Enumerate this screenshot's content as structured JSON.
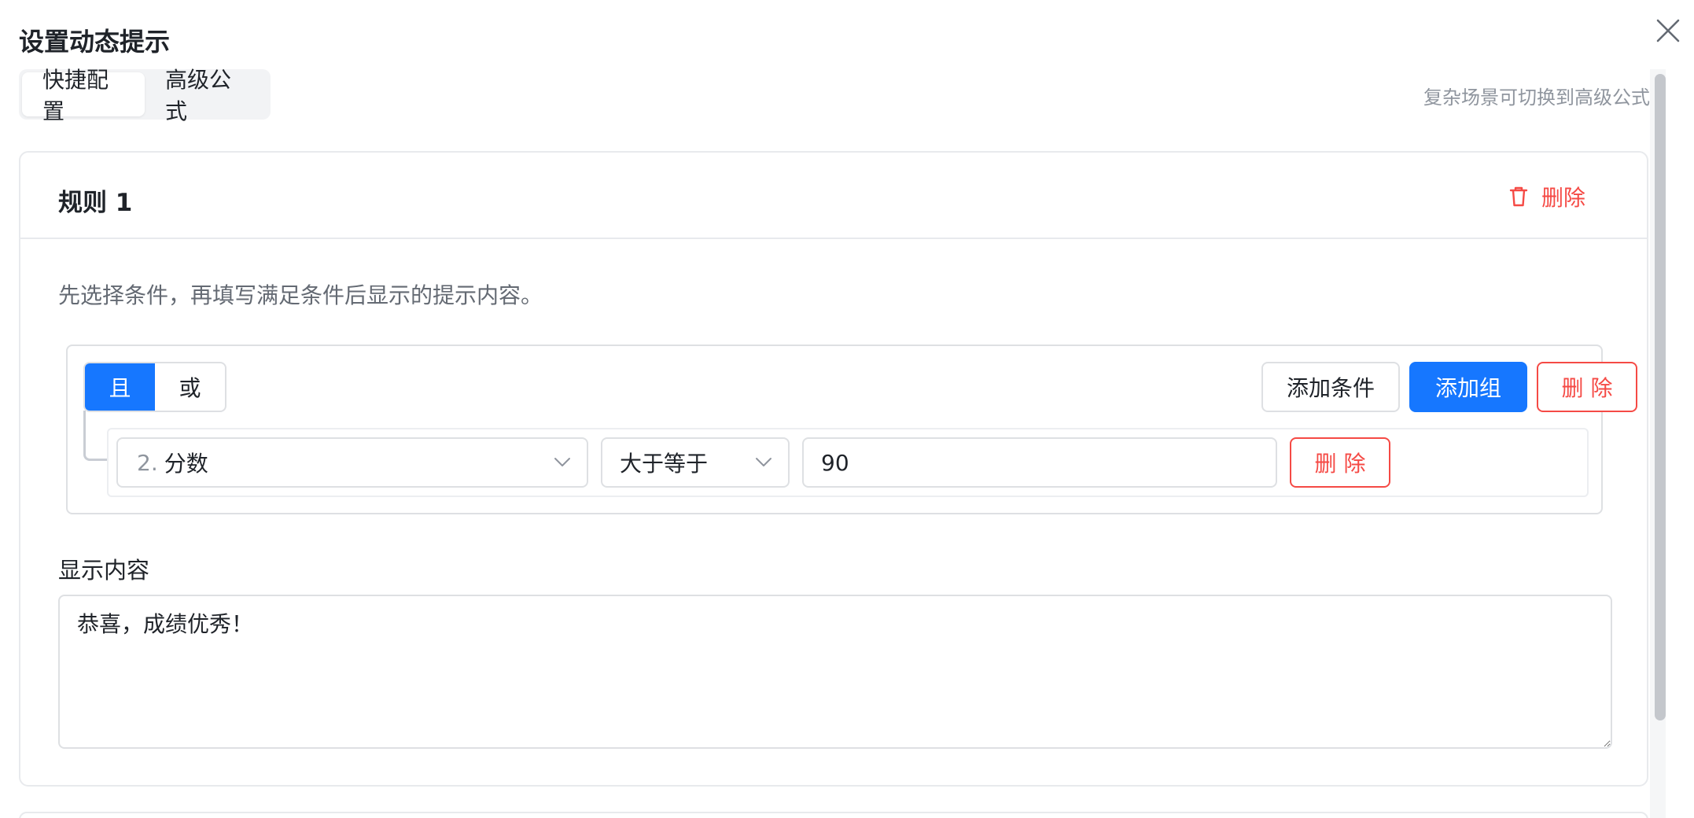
{
  "dialog": {
    "title": "设置动态提示",
    "close_icon": "close-icon"
  },
  "mode_tabs": [
    {
      "label": "快捷配置",
      "active": true
    },
    {
      "label": "高级公式",
      "active": false
    }
  ],
  "hint_right": "复杂场景可切换到高级公式",
  "rule": {
    "title": "规则 1",
    "delete_label": "删除",
    "delete_icon": "trash-icon",
    "description": "先选择条件，再填写满足条件后显示的提示内容。",
    "logic": {
      "and_label": "且",
      "or_label": "或",
      "selected": "且"
    },
    "buttons": {
      "add_condition": "添加条件",
      "add_group": "添加组",
      "delete_group": "删 除"
    },
    "condition": {
      "field_prefix": "2.",
      "field_label": "分数",
      "operator": "大于等于",
      "value": "90",
      "delete_label": "删 除"
    },
    "content_label": "显示内容",
    "content_value": "恭喜，成绩优秀！"
  },
  "colors": {
    "primary": "#1677ff",
    "danger": "#f54a45",
    "border": "#dee0e3",
    "muted_text": "#8f959e"
  }
}
